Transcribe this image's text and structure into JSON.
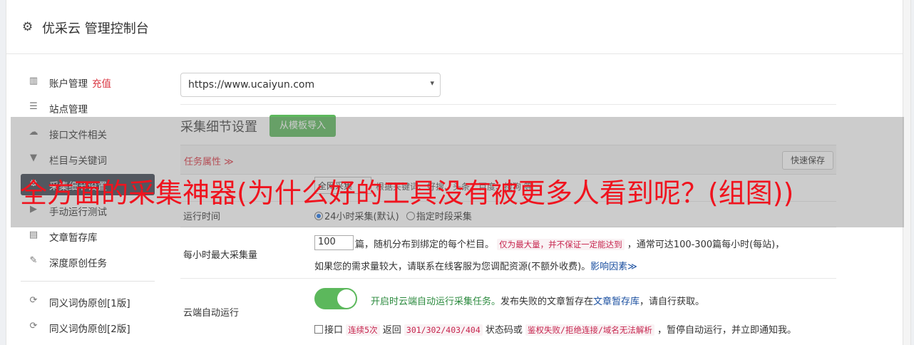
{
  "header": {
    "title": "优采云 管理控制台",
    "icon": "gear-icon"
  },
  "sidebar": {
    "items": [
      {
        "icon": "bar-chart-icon",
        "label": "账户管理",
        "badge": "充值"
      },
      {
        "icon": "server-icon",
        "label": "站点管理"
      },
      {
        "icon": "cloud-upload-icon",
        "label": "接口文件相关"
      },
      {
        "icon": "filter-icon",
        "label": "栏目与关键词"
      },
      {
        "icon": "settings-icon",
        "label": "采集细节设置"
      },
      {
        "icon": "play-icon",
        "label": "手动运行测试"
      },
      {
        "icon": "folder-icon",
        "label": "文章暂存库"
      },
      {
        "icon": "edit-icon",
        "label": "深度原创任务"
      },
      {
        "icon": "refresh-icon",
        "label": "同义词伪原创[1版]"
      },
      {
        "icon": "refresh-icon",
        "label": "同义词伪原创[2版]"
      }
    ]
  },
  "main": {
    "site_select": {
      "value": "https://www.ucaiyun.com"
    },
    "section_title": "采集细节设置",
    "import_button": "从模板导入",
    "task_props": "任务属性 ≫",
    "quick_save": "快速保存",
    "mode": {
      "value": "全网采集",
      "desc": "根据关键词、好搜、头条、百度、搜狗 等"
    },
    "runtime": {
      "label": "运行时间",
      "opt1": "24小时采集(默认)",
      "opt2": "指定时段采集"
    },
    "max_per_hour": {
      "label": "每小时最大采集量",
      "value": "100",
      "text1": "篇，随机分布到绑定的每个栏目。",
      "note": "仅为最大量，并不保证一定能达到",
      "text2": "，通常可达100-300篇每小时(每站)，",
      "text3": "如果您的需求量较大，请联系在线客服为您调配资源(不额外收费)。",
      "link": "影响因素≫"
    },
    "cloud_run": {
      "label": "云端自动运行",
      "enabled_text": "开启时云端自动运行采集任务。",
      "text_a": "发布失败的文章暂存在",
      "link": "文章暂存库",
      "text_b": "，请自行获取。",
      "chk_label": "接口",
      "c1": "连续5次",
      "t1": "返回",
      "c2": "301/302/403/404",
      "t2": "状态码或",
      "c3": "鉴权失败/拒绝连接/域名无法解析",
      "t3": "，暂停自动运行，并立即通知我。"
    }
  },
  "watermark": "全方面的采集神器(为什么好的工具没有被更多人看到呢？(组图))"
}
